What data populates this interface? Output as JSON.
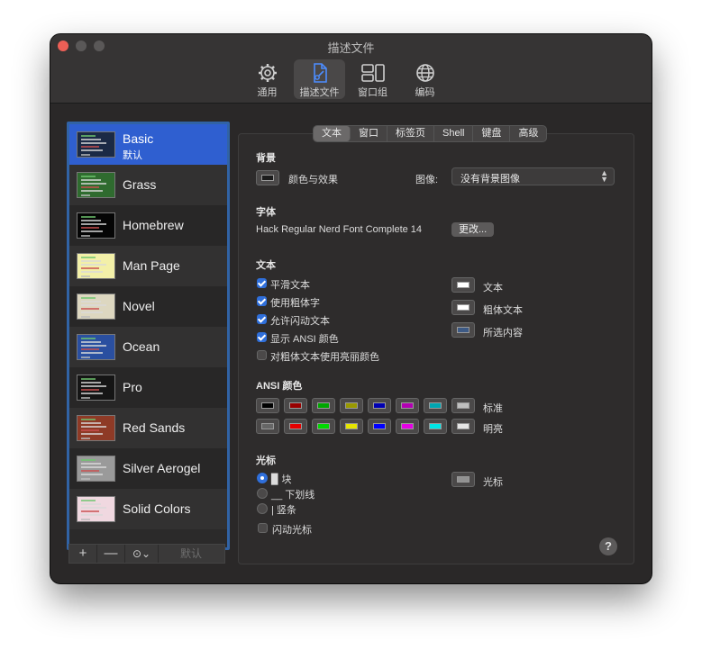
{
  "window": {
    "title": "描述文件"
  },
  "toolbar": [
    {
      "label": "通用",
      "icon": "gear-icon"
    },
    {
      "label": "描述文件",
      "icon": "document-icon"
    },
    {
      "label": "窗口组",
      "icon": "window-group-icon"
    },
    {
      "label": "编码",
      "icon": "globe-icon"
    }
  ],
  "profiles": [
    {
      "name": "Basic",
      "subtitle": "默认",
      "selected": true,
      "thumb_bg": "#1b2a45"
    },
    {
      "name": "Grass",
      "thumb_bg": "#2f6b2f"
    },
    {
      "name": "Homebrew",
      "thumb_bg": "#050505"
    },
    {
      "name": "Man Page",
      "thumb_bg": "#f3f0a8"
    },
    {
      "name": "Novel",
      "thumb_bg": "#ddd7c0"
    },
    {
      "name": "Ocean",
      "thumb_bg": "#2a4fa0"
    },
    {
      "name": "Pro",
      "thumb_bg": "#151515"
    },
    {
      "name": "Red Sands",
      "thumb_bg": "#8e3a26"
    },
    {
      "name": "Silver Aerogel",
      "thumb_bg": "#9a9a9a"
    },
    {
      "name": "Solid Colors",
      "thumb_bg": "#f0d8e0"
    }
  ],
  "sidebar_tools": {
    "add": "+",
    "remove": "—",
    "more": "⊙⌄",
    "default": "默认"
  },
  "tabs": [
    "文本",
    "窗口",
    "标签页",
    "Shell",
    "键盘",
    "高级"
  ],
  "background": {
    "heading": "背景",
    "color_effects": "颜色与效果",
    "image_label": "图像:",
    "image_value": "没有背景图像"
  },
  "font": {
    "heading": "字体",
    "value": "Hack Regular Nerd Font Complete 14",
    "change_button": "更改..."
  },
  "text": {
    "heading": "文本",
    "options": [
      {
        "label": "平滑文本",
        "checked": true
      },
      {
        "label": "使用粗体字",
        "checked": true
      },
      {
        "label": "允许闪动文本",
        "checked": true
      },
      {
        "label": "显示 ANSI 颜色",
        "checked": true
      },
      {
        "label": "对粗体文本使用亮丽颜色",
        "checked": false
      }
    ],
    "colors": [
      {
        "label": "文本",
        "color": "#ffffff"
      },
      {
        "label": "粗体文本",
        "color": "#ffffff"
      },
      {
        "label": "所选内容",
        "color": "#3d5a85"
      }
    ]
  },
  "ansi": {
    "heading": "ANSI 颜色",
    "normal_label": "标准",
    "bright_label": "明亮",
    "normal": [
      "#000000",
      "#990000",
      "#00a600",
      "#999900",
      "#0000b2",
      "#b200b2",
      "#00a6b2",
      "#bfbfbf"
    ],
    "bright": [
      "#666666",
      "#e50000",
      "#00d900",
      "#e5e500",
      "#0000ff",
      "#e500e5",
      "#00e5e5",
      "#e5e5e5"
    ]
  },
  "cursor": {
    "heading": "光标",
    "options": [
      {
        "label": "▉ 块",
        "selected": true
      },
      {
        "label": "__ 下划线",
        "selected": false
      },
      {
        "label": "| 竖条",
        "selected": false
      }
    ],
    "blink": {
      "label": "闪动光标",
      "checked": false
    },
    "color_label": "光标",
    "color": "#929292"
  },
  "help": "?"
}
